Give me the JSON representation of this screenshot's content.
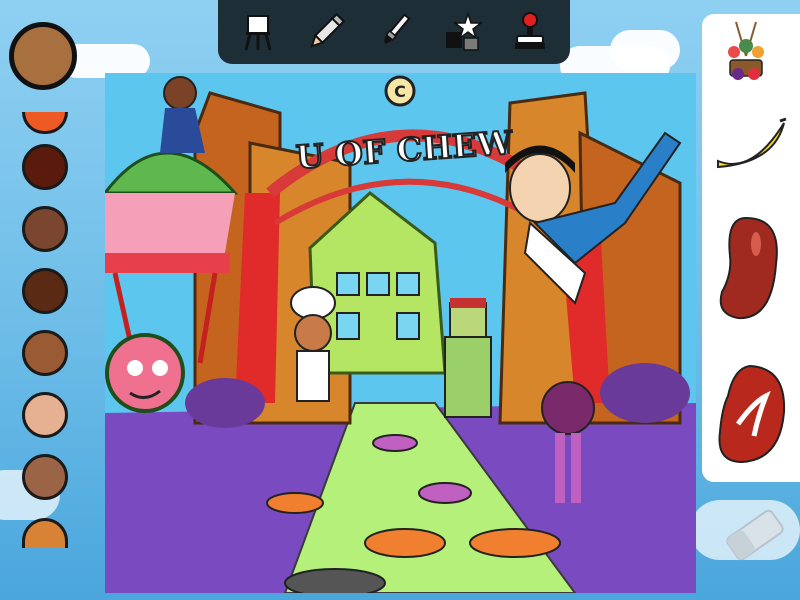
{
  "palette": {
    "selected_color": "#a8703f",
    "swatches": [
      {
        "name": "orange-red",
        "color": "#ee5a24"
      },
      {
        "name": "dark-red-brown",
        "color": "#5a1a0c"
      },
      {
        "name": "medium-brown",
        "color": "#7a4630"
      },
      {
        "name": "dark-brown",
        "color": "#5a2a14"
      },
      {
        "name": "sienna",
        "color": "#9a5a34"
      },
      {
        "name": "peach",
        "color": "#e6b092"
      },
      {
        "name": "tan-brown",
        "color": "#9c6446"
      },
      {
        "name": "orange-tan",
        "color": "#d88236"
      }
    ]
  },
  "toolbar": {
    "tools": [
      "easel-icon",
      "pencil-icon",
      "paintbrush-icon",
      "stickers-icon",
      "stamp-icon"
    ]
  },
  "canvas": {
    "arch_sign": "U OF CHEW",
    "emblem": "C"
  },
  "stickers": [
    "balloon-basket-sticker",
    "banana-sticker",
    "kidney-bean-sticker",
    "steak-sticker"
  ],
  "eraser": {
    "icon": "eraser-icon"
  }
}
